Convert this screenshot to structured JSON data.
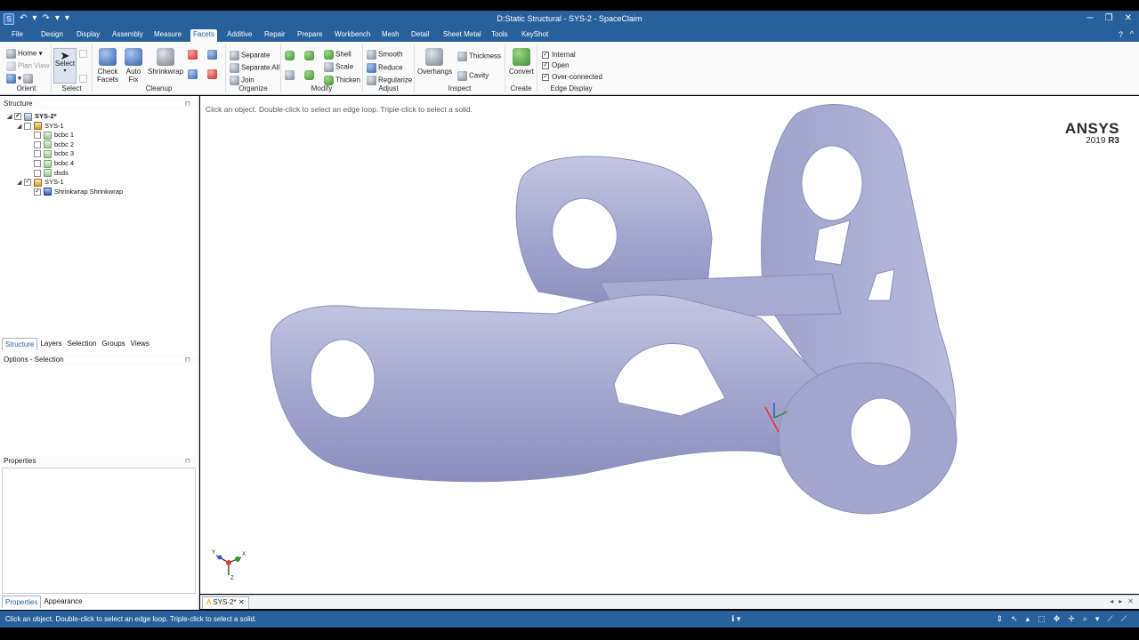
{
  "window": {
    "title": "D:Static Structural - SYS-2 - SpaceClaim",
    "controls": [
      "─",
      "❐",
      "✕"
    ]
  },
  "quick_access": [
    "↶",
    "▾",
    "↷",
    "▾",
    "▾"
  ],
  "menu": {
    "items": [
      "File",
      "Design",
      "Display",
      "Assembly",
      "Measure",
      "Facets",
      "Additive",
      "Repair",
      "Prepare",
      "Workbench",
      "Mesh",
      "Detail",
      "Sheet Metal",
      "Tools",
      "KeyShot"
    ],
    "active": "Facets",
    "help": "?",
    "collapse": "^"
  },
  "ribbon": {
    "orient": {
      "label": "Orient",
      "home": "Home",
      "plan_view": "Plan View"
    },
    "select": {
      "label": "Select",
      "select_btn": "Select"
    },
    "cleanup": {
      "label": "Cleanup",
      "check_facets": "Check Facets",
      "auto_fix": "Auto Fix",
      "shrinkwrap": "Shrinkwrap"
    },
    "organize": {
      "label": "Organize",
      "separate": "Separate",
      "separate_all": "Separate All",
      "join": "Join"
    },
    "modify": {
      "label": "Modify",
      "shell": "Shell",
      "scale": "Scale",
      "thicken": "Thicken"
    },
    "adjust": {
      "label": "Adjust",
      "smooth": "Smooth",
      "reduce": "Reduce",
      "regularize": "Regularize"
    },
    "inspect": {
      "label": "Inspect",
      "overhangs": "Overhangs",
      "thickness": "Thickness",
      "cavity": "Cavity"
    },
    "create": {
      "label": "Create",
      "convert": "Convert"
    },
    "edge_display": {
      "label": "Edge Display",
      "internal": "Internal",
      "open": "Open",
      "over_connected": "Over-connected"
    }
  },
  "structure": {
    "header": "Structure",
    "tree": [
      {
        "level": 0,
        "expander": "◢",
        "checked": true,
        "icon": "root",
        "label": "SYS-2*",
        "bold": true
      },
      {
        "level": 1,
        "expander": "◢",
        "checked": false,
        "icon": "comp",
        "label": "SYS-1"
      },
      {
        "level": 2,
        "expander": "",
        "checked": false,
        "icon": "body",
        "label": "bcbc 1"
      },
      {
        "level": 2,
        "expander": "",
        "checked": false,
        "icon": "body",
        "label": "bcbc 2"
      },
      {
        "level": 2,
        "expander": "",
        "checked": false,
        "icon": "body",
        "label": "bcbc 3"
      },
      {
        "level": 2,
        "expander": "",
        "checked": false,
        "icon": "body",
        "label": "bcbc 4"
      },
      {
        "level": 2,
        "expander": "",
        "checked": false,
        "icon": "body",
        "label": "dsds"
      },
      {
        "level": 1,
        "expander": "◢",
        "checked": true,
        "icon": "comp",
        "label": "SYS-1"
      },
      {
        "level": 2,
        "expander": "",
        "checked": true,
        "icon": "shrink",
        "label": "Shrinkwrap Shrinkwrap"
      }
    ],
    "tabs": [
      "Structure",
      "Layers",
      "Selection",
      "Groups",
      "Views"
    ]
  },
  "options": {
    "header": "Options - Selection"
  },
  "properties": {
    "header": "Properties",
    "tabs": [
      "Properties",
      "Appearance"
    ]
  },
  "viewport": {
    "hint": "Click an object. Double-click to select an edge loop. Triple-click to select a solid.",
    "brand": "ANSYS",
    "version_year": "2019",
    "version_release": "R3",
    "model_color": "#a4a8cf",
    "triad_axes": [
      "Y",
      "X",
      "Z"
    ]
  },
  "doc_tabs": {
    "active": "SYS-2*",
    "close": "✕",
    "nav": [
      "◂",
      "▸",
      "✕"
    ]
  },
  "status": {
    "text": "Click an object. Double-click to select an edge loop. Triple-click to select a solid.",
    "info": "ℹ ▾",
    "tools": [
      "⇕",
      "↖",
      "▴",
      "⬚",
      "✥",
      "✛",
      "⌕",
      "▾",
      "⟋",
      "⟋"
    ]
  }
}
